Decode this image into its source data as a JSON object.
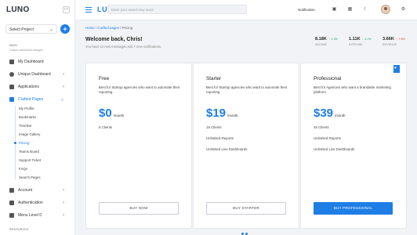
{
  "app": {
    "brand": "LUNO",
    "logo_text": "LUNO"
  },
  "sidebar": {
    "project_select": "Select Project",
    "add_label": "+",
    "main_label": "MAIN",
    "main_sub": "Unique dashboard designs",
    "items": [
      {
        "label": "My Dashboard"
      },
      {
        "label": "Unique Dashboard"
      },
      {
        "label": "Applications"
      },
      {
        "label": "Crafted Pages"
      },
      {
        "label": "Account"
      },
      {
        "label": "Authentication"
      },
      {
        "label": "Menu Level 0"
      }
    ],
    "sub_items": [
      "My Profile",
      "Bookmarks",
      "Timeline",
      "Image Gallery",
      "Pricing",
      "Teams Board",
      "Support Ticket",
      "FAQs",
      "Search Pages"
    ],
    "resources_label": "RESOURCES"
  },
  "topbar": {
    "search_placeholder": "Enter your search key word",
    "notification": "Notification"
  },
  "breadcrumb": {
    "home": "Home",
    "crafted": "Crafted pages",
    "current": "Pricing",
    "sep": "/"
  },
  "welcome": {
    "title": "Welcome back, Chris!",
    "subtitle": "You have 12 new messages and 7 new notifications."
  },
  "stats": [
    {
      "value": "8.18K",
      "delta": "↑ 1.3%",
      "label": "INCOME",
      "color": "#19a974"
    },
    {
      "value": "1.11K",
      "delta": "↑ 4.1%",
      "label": "EXPENSE",
      "color": "#19a974"
    },
    {
      "value": "3.66K",
      "delta": "↑ 7.5%",
      "label": "REVENUE",
      "color": "#e04848"
    }
  ],
  "plans": [
    {
      "title": "Free",
      "desc": "Best for Startup agencies who want to automate their reporting.",
      "price": "$0",
      "per": "/month",
      "features": [
        "5 Clients"
      ],
      "button": "BUY NOW"
    },
    {
      "title": "Starter",
      "desc": "Best for Startup agencies who want to automate their reporting.",
      "price": "$19",
      "per": "/month",
      "features": [
        "15 Clients",
        "Unlimited Reports",
        "Unlimited Live Dashboards"
      ],
      "button": "BUY STARTER"
    },
    {
      "title": "Professional",
      "desc": "Best for Agencies who want a brandable marketing platform",
      "price": "$39",
      "per": "/month",
      "features": [
        "45 Clients",
        "Unlimited Reports",
        "Unlimited Live Dashboards"
      ],
      "button": "BUY PROFESSIONAL"
    }
  ],
  "colors": {
    "accent": "#1e7ee6"
  }
}
